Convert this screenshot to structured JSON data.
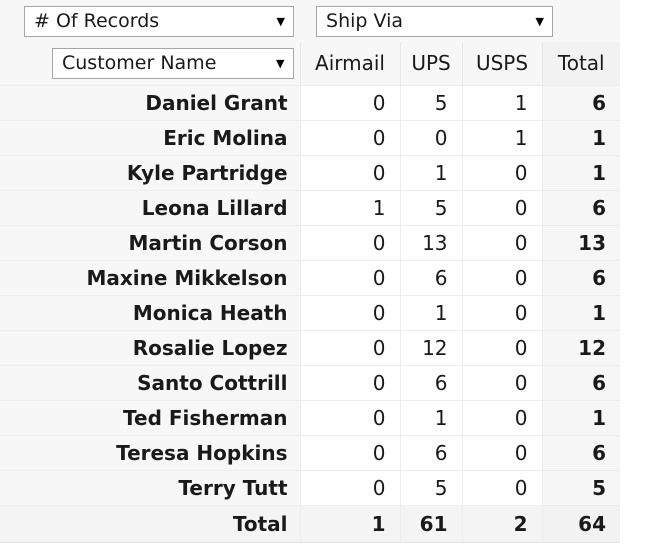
{
  "controls": {
    "measure": {
      "label": "# Of Records",
      "caret": "chevron-down-icon"
    },
    "row_field": {
      "label": "Customer Name",
      "caret": "chevron-down-icon"
    },
    "column_field": {
      "label": "Ship Via",
      "caret": "chevron-down-icon"
    }
  },
  "chart_data": {
    "type": "table",
    "title": "",
    "row_field": "Customer Name",
    "column_field": "Ship Via",
    "measure": "# Of Records",
    "columns": [
      "Airmail",
      "UPS",
      "USPS",
      "Total"
    ],
    "categories": [
      "Daniel Grant",
      "Eric Molina",
      "Kyle Partridge",
      "Leona Lillard",
      "Martin Corson",
      "Maxine Mikkelson",
      "Monica Heath",
      "Rosalie Lopez",
      "Santo Cottrill",
      "Ted Fisherman",
      "Teresa Hopkins",
      "Terry Tutt"
    ],
    "series": [
      {
        "name": "Airmail",
        "values": [
          0,
          0,
          0,
          1,
          0,
          0,
          0,
          0,
          0,
          0,
          0,
          0
        ]
      },
      {
        "name": "UPS",
        "values": [
          5,
          0,
          1,
          5,
          13,
          6,
          1,
          12,
          6,
          1,
          6,
          5
        ]
      },
      {
        "name": "USPS",
        "values": [
          1,
          1,
          0,
          0,
          0,
          0,
          0,
          0,
          0,
          0,
          0,
          0
        ]
      },
      {
        "name": "Total",
        "values": [
          6,
          1,
          1,
          6,
          13,
          6,
          1,
          12,
          6,
          1,
          6,
          5
        ]
      }
    ],
    "grand_total_label": "Total",
    "grand_totals": [
      1,
      61,
      2,
      64
    ]
  },
  "table": {
    "headers": [
      "Airmail",
      "UPS",
      "USPS",
      "Total"
    ],
    "rows": [
      {
        "name": "Daniel Grant",
        "cells": [
          "0",
          "5",
          "1",
          "6"
        ]
      },
      {
        "name": "Eric Molina",
        "cells": [
          "0",
          "0",
          "1",
          "1"
        ]
      },
      {
        "name": "Kyle Partridge",
        "cells": [
          "0",
          "1",
          "0",
          "1"
        ]
      },
      {
        "name": "Leona Lillard",
        "cells": [
          "1",
          "5",
          "0",
          "6"
        ]
      },
      {
        "name": "Martin Corson",
        "cells": [
          "0",
          "13",
          "0",
          "13"
        ]
      },
      {
        "name": "Maxine Mikkelson",
        "cells": [
          "0",
          "6",
          "0",
          "6"
        ]
      },
      {
        "name": "Monica Heath",
        "cells": [
          "0",
          "1",
          "0",
          "1"
        ]
      },
      {
        "name": "Rosalie Lopez",
        "cells": [
          "0",
          "12",
          "0",
          "12"
        ]
      },
      {
        "name": "Santo Cottrill",
        "cells": [
          "0",
          "6",
          "0",
          "6"
        ]
      },
      {
        "name": "Ted Fisherman",
        "cells": [
          "0",
          "1",
          "0",
          "1"
        ]
      },
      {
        "name": "Teresa Hopkins",
        "cells": [
          "0",
          "6",
          "0",
          "6"
        ]
      },
      {
        "name": "Terry Tutt",
        "cells": [
          "0",
          "5",
          "0",
          "5"
        ]
      }
    ],
    "total_row": {
      "name": "Total",
      "cells": [
        "1",
        "61",
        "2",
        "64"
      ]
    }
  },
  "glyphs": {
    "caret_down": "▼"
  },
  "colors": {
    "header_bg": "#f7f7f7",
    "total_bg": "#f2f2f2",
    "cell_bg": "#ffffff",
    "grid_line": "#ededed",
    "text": "#1a1a1a",
    "control_border": "#a6a6a6"
  }
}
